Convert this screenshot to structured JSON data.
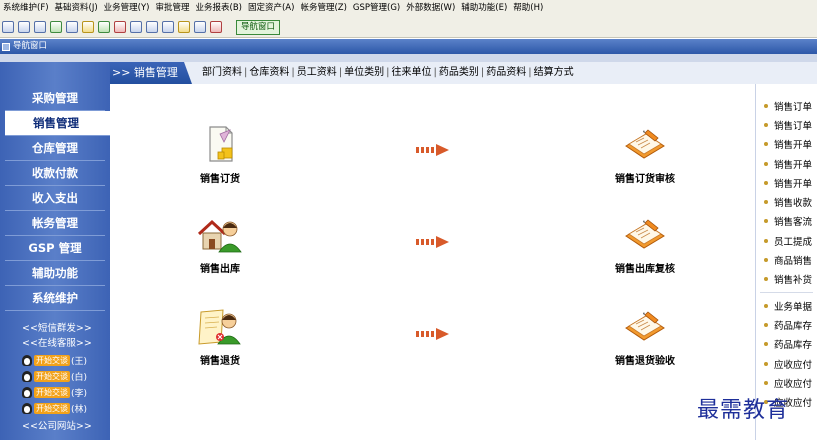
{
  "menubar": [
    "系统维护(F)",
    "基础资料(J)",
    "业务管理(Y)",
    "审批管理",
    "业务报表(B)",
    "固定资产(A)",
    "帐务管理(Z)",
    "GSP管理(G)",
    "外部数据(W)",
    "辅助功能(E)",
    "帮助(H)"
  ],
  "toolbar": {
    "nav_button": "导航窗口"
  },
  "window_title": "导航窗口",
  "sidebar": {
    "items": [
      "采购管理",
      "销售管理",
      "仓库管理",
      "收款付款",
      "收入支出",
      "帐务管理",
      "GSP 管理",
      "辅助功能",
      "系统维护"
    ],
    "active_index": 1,
    "links": [
      "<<短信群发>>",
      "<<在线客服>>"
    ],
    "qq": [
      {
        "tag": "开始交谈",
        "who": "(王)"
      },
      {
        "tag": "开始交谈",
        "who": "(白)"
      },
      {
        "tag": "开始交谈",
        "who": "(李)"
      },
      {
        "tag": "开始交谈",
        "who": "(林)"
      }
    ],
    "bottom_link": "<<公司网站>>"
  },
  "tabs": {
    "header": ">> 销售管理",
    "links": [
      "部门资料",
      "仓库资料",
      "员工资料",
      "单位类别",
      "往来单位",
      "药品类别",
      "药品资料",
      "结算方式"
    ]
  },
  "flow": {
    "left": [
      "销售订货",
      "销售出库",
      "销售退货"
    ],
    "right": [
      "销售订货审核",
      "销售出库复核",
      "销售退货验收"
    ]
  },
  "right_list": {
    "group1": [
      "销售订单",
      "销售订单",
      "销售开单",
      "销售开单",
      "销售开单",
      "销售收款",
      "销售客流",
      "员工提成",
      "商品销售",
      "销售补货"
    ],
    "group2": [
      "业务单据",
      "药品库存",
      "药品库存",
      "应收应付",
      "应收应付",
      "应收应付"
    ]
  },
  "watermark": "最需教育",
  "colors": {
    "sidebar": "#4a6fc0",
    "accent": "#e06a2a"
  }
}
